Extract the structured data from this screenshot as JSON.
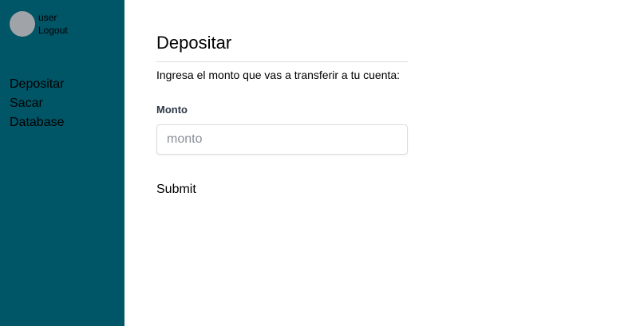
{
  "sidebar": {
    "user": {
      "name": "user",
      "logout_label": "Logout"
    },
    "items": [
      {
        "label": "Depositar"
      },
      {
        "label": "Sacar"
      },
      {
        "label": "Database"
      }
    ]
  },
  "main": {
    "title": "Depositar",
    "subtitle": "Ingresa el monto que vas a transferir a tu cuenta:",
    "form": {
      "monto_label": "Monto",
      "monto_placeholder": "monto",
      "monto_value": "",
      "submit_label": "Submit"
    }
  },
  "colors": {
    "sidebar_bg": "#005566",
    "avatar": "#a0a3a8",
    "divider": "#dcdde0"
  }
}
